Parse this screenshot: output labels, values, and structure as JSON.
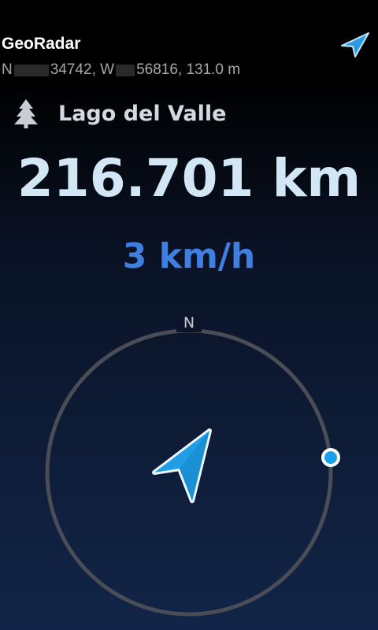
{
  "header": {
    "app_title": "GeoRadar",
    "coords": {
      "lat_prefix": "N",
      "lat_visible": "34742, W",
      "lon_visible": "56816, 131.0 m"
    },
    "nav_icon": "navigation-arrow-icon"
  },
  "destination": {
    "icon": "pine-tree-icon",
    "name": "Lago del Valle"
  },
  "distance": "216.701 km",
  "speed": "3 km/h",
  "compass": {
    "north_label": "N",
    "ring_color": "#4a4d55",
    "arrow_color": "#1f9ee6",
    "marker_color": "#1aa0ea"
  }
}
